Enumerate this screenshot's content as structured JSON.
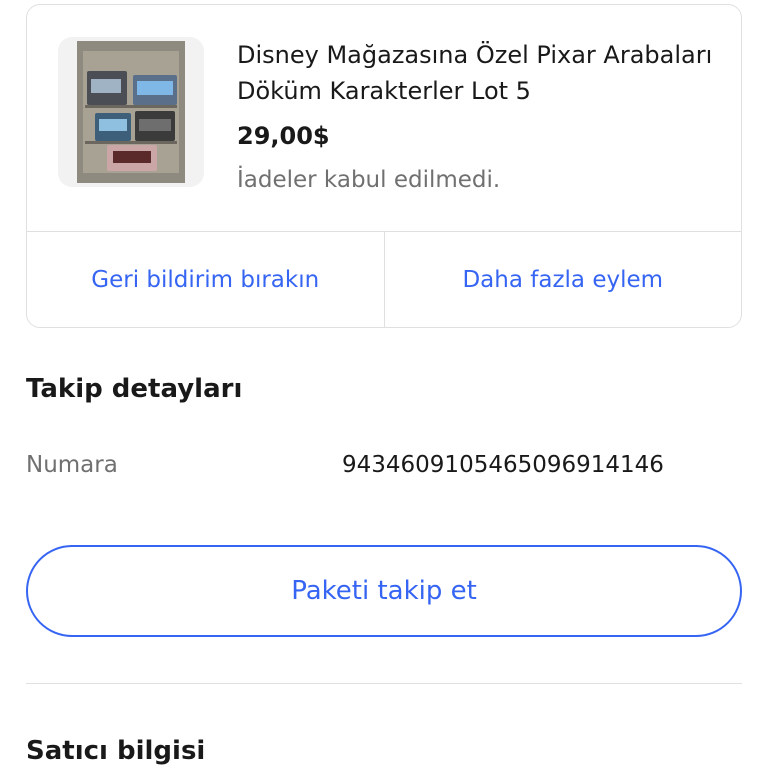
{
  "order_item": {
    "title": "Disney Mağazasına Özel Pixar Arabaları Döküm Karakterler Lot 5",
    "price": "29,00$",
    "returns": "İadeler kabul edilmedi.",
    "actions": [
      {
        "label": "Geri bildirim bırakın"
      },
      {
        "label": "Daha fazla eylem"
      }
    ]
  },
  "tracking": {
    "heading": "Takip detayları",
    "number_label": "Numara",
    "number_value": "9434609105465096914146",
    "track_button": "Paketi takip et"
  },
  "seller": {
    "heading": "Satıcı bilgisi"
  },
  "colors": {
    "accent": "#3665f3",
    "text": "#191919",
    "muted": "#707070",
    "border": "#e0e0e0"
  }
}
